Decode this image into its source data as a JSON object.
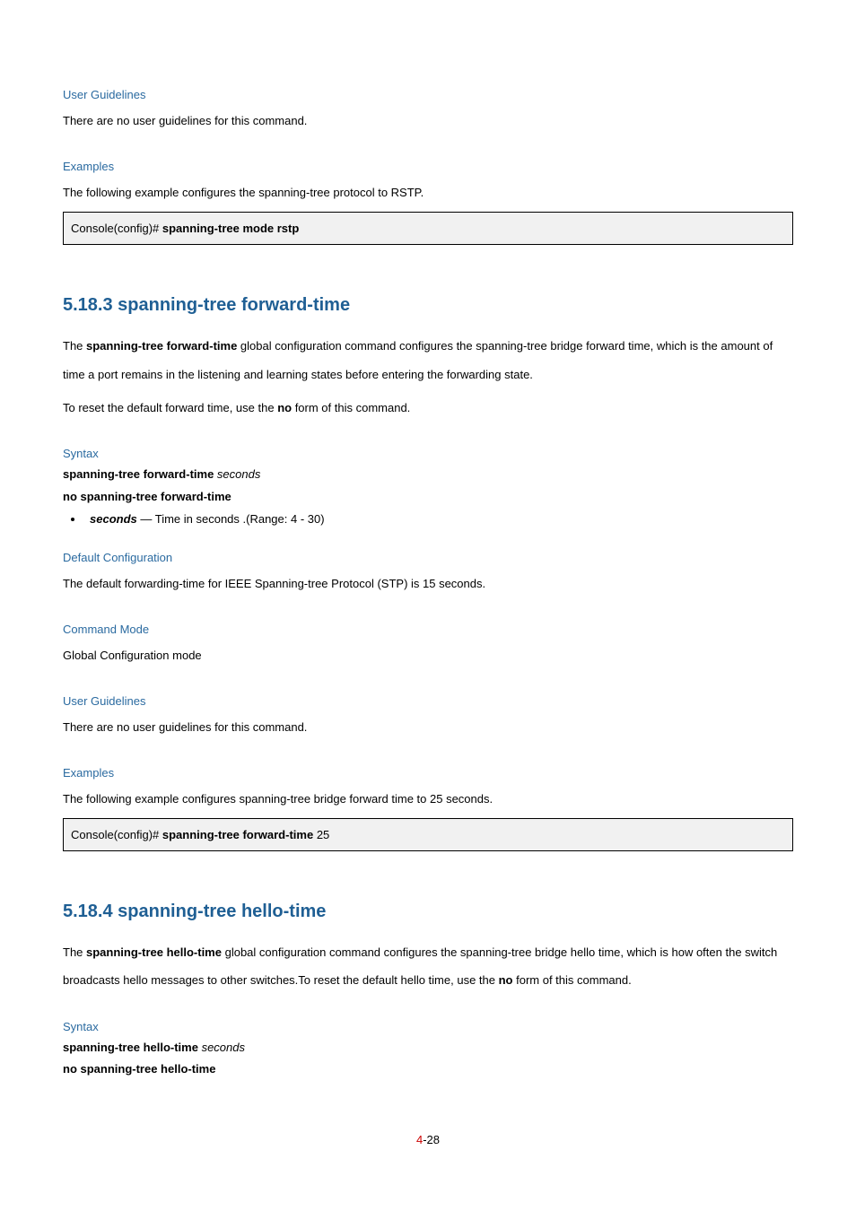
{
  "sec1": {
    "heading": "User Guidelines",
    "text": "There are no user guidelines for this command."
  },
  "sec2": {
    "heading": "Examples",
    "text": "The following example configures the spanning-tree protocol to RSTP.",
    "code_prompt": "Console(config)# ",
    "code_cmd": "spanning-tree mode rstp"
  },
  "cmd1": {
    "title": "5.18.3 spanning-tree forward-time",
    "desc_pre": "The ",
    "desc_bold": "spanning-tree forward-time",
    "desc_mid": " global configuration command configures the spanning-tree bridge forward time, which is the amount of time a port remains in the listening and learning states before entering the forwarding state.",
    "desc2_pre": "To reset the default forward time, use the ",
    "desc2_bold": "no",
    "desc2_post": " form of this command.",
    "syntax_heading": "Syntax",
    "syntax1_cmd": "spanning-tree forward-time ",
    "syntax1_param": "seconds",
    "syntax2": "no spanning-tree forward-time",
    "param_name": "seconds",
    "param_desc": " — Time in seconds .(Range: 4 - 30)",
    "default_heading": "Default Configuration",
    "default_text": "The default forwarding-time for IEEE Spanning-tree Protocol (STP) is 15 seconds.",
    "mode_heading": "Command Mode",
    "mode_text": "Global Configuration mode",
    "ug_heading": "User Guidelines",
    "ug_text": "There are no user guidelines for this command.",
    "ex_heading": "Examples",
    "ex_text": "The following example configures spanning-tree bridge forward time to 25 seconds.",
    "ex_code_prompt": "Console(config)# ",
    "ex_code_cmd": "spanning-tree forward-time ",
    "ex_code_arg": "25"
  },
  "cmd2": {
    "title": "5.18.4 spanning-tree hello-time",
    "desc_pre": "The ",
    "desc_bold": "spanning-tree hello-time",
    "desc_mid": " global configuration command configures the spanning-tree bridge hello time, which is how often the switch broadcasts hello messages to other switches.To reset the default hello time, use the ",
    "desc_bold2": "no",
    "desc_post": " form of this command.",
    "syntax_heading": "Syntax",
    "syntax1_cmd": "spanning-tree hello-time ",
    "syntax1_param": "seconds",
    "syntax2": "no spanning-tree hello-time"
  },
  "pagenum": {
    "four": "4",
    "rest": "-28"
  }
}
